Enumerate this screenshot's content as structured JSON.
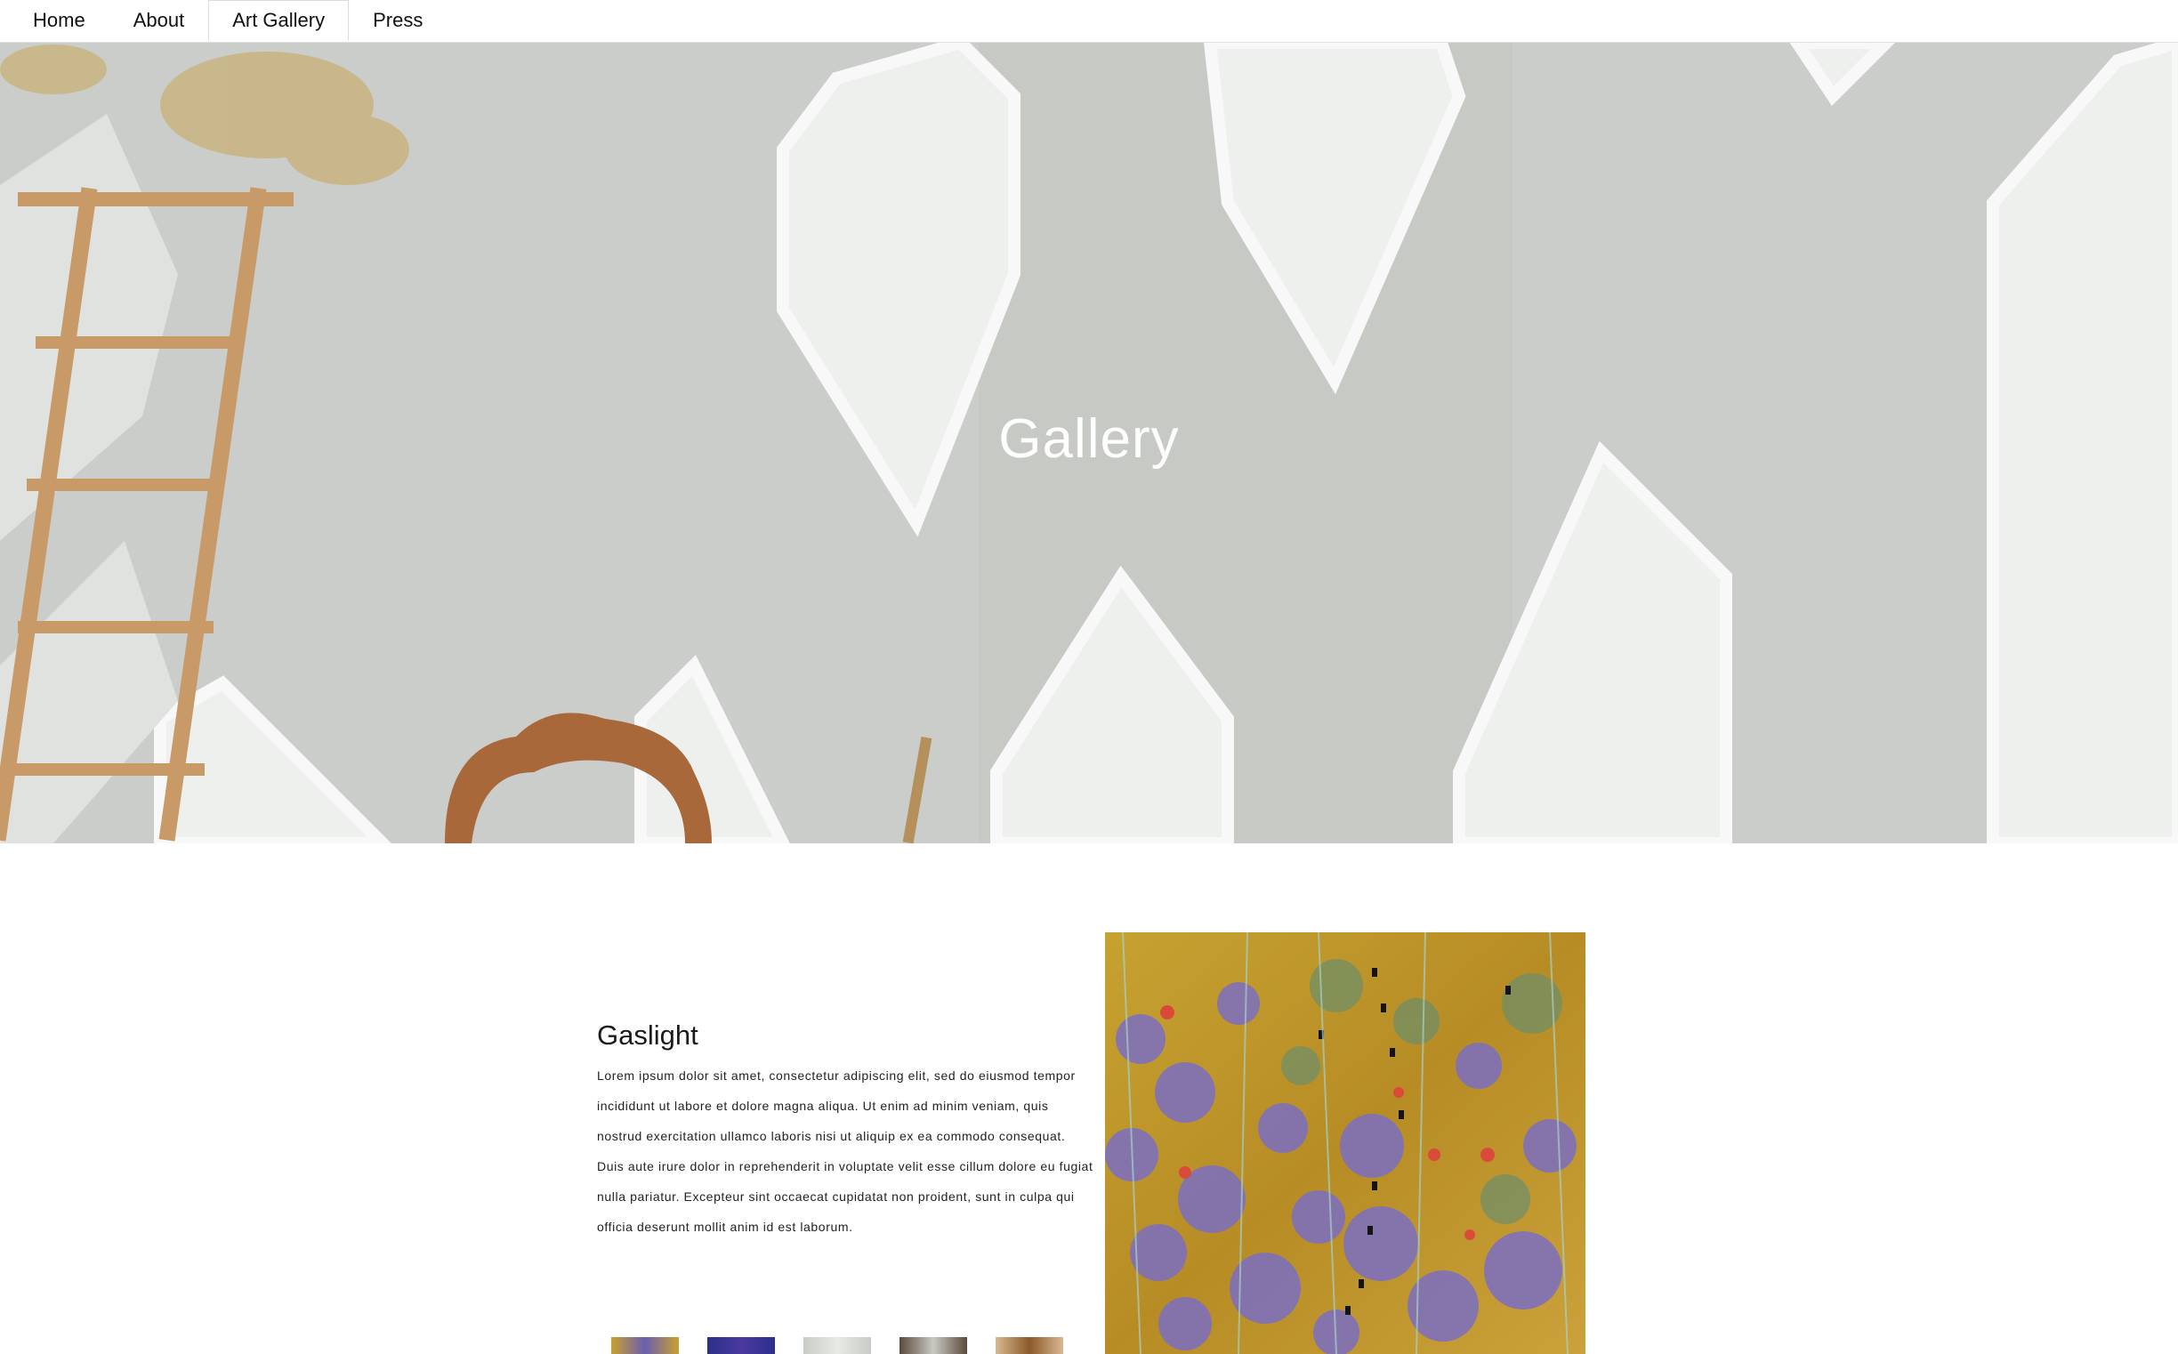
{
  "nav": {
    "tabs": [
      {
        "label": "Home"
      },
      {
        "label": "About"
      },
      {
        "label": "Art Gallery",
        "active": true
      },
      {
        "label": "Press"
      }
    ]
  },
  "hero": {
    "title": "Gallery"
  },
  "artwork": {
    "title": "Gaslight",
    "description": "Lorem ipsum dolor sit amet, consectetur adipiscing elit, sed do eiusmod tempor incididunt ut labore et dolore magna aliqua. Ut enim ad minim veniam, quis nostrud exercitation ullamco laboris nisi ut aliquip ex ea commodo consequat. Duis aute irure dolor in reprehenderit in voluptate velit esse cillum dolore eu fugiat nulla pariatur. Excepteur sint occaecat cupidatat non proident, sunt in culpa qui officia deserunt mollit anim id est laborum."
  },
  "thumbnails": [
    {
      "colors": [
        "#c9a12e",
        "#6a5fb0"
      ]
    },
    {
      "colors": [
        "#2c2f8a",
        "#4a3aa0"
      ]
    },
    {
      "colors": [
        "#c8cbc6",
        "#e8eae6"
      ]
    },
    {
      "colors": [
        "#5b4a3a",
        "#c9c9c4"
      ]
    },
    {
      "colors": [
        "#d9b891",
        "#8a5a2a"
      ]
    }
  ],
  "colors": {
    "hero_bg": "#cbcfcb",
    "nav_bg": "#ffffff",
    "text": "#1b1b1b"
  }
}
